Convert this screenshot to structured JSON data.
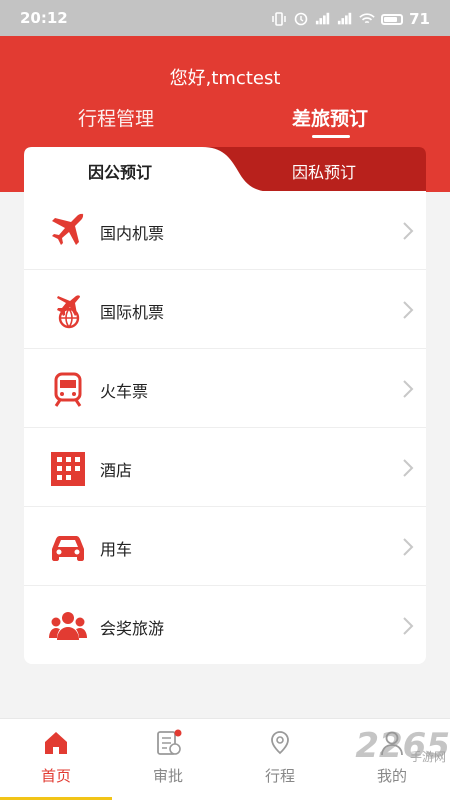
{
  "status_bar": {
    "time": "20:12",
    "battery": "71"
  },
  "header": {
    "greeting": "您好,tmctest",
    "tabs": [
      {
        "label": "行程管理",
        "active": false
      },
      {
        "label": "差旅预订",
        "active": true
      }
    ]
  },
  "booking_tabs": [
    {
      "label": "因公预订",
      "active": true
    },
    {
      "label": "因私预订",
      "active": false
    }
  ],
  "services": [
    {
      "label": "国内机票",
      "icon": "plane-icon"
    },
    {
      "label": "国际机票",
      "icon": "globe-plane-icon"
    },
    {
      "label": "火车票",
      "icon": "train-icon"
    },
    {
      "label": "酒店",
      "icon": "hotel-icon"
    },
    {
      "label": "用车",
      "icon": "car-icon"
    },
    {
      "label": "会奖旅游",
      "icon": "group-icon"
    }
  ],
  "bottom_nav": [
    {
      "label": "首页",
      "icon": "home-icon",
      "active": true
    },
    {
      "label": "审批",
      "icon": "approval-icon",
      "active": false
    },
    {
      "label": "行程",
      "icon": "location-icon",
      "active": false
    },
    {
      "label": "我的",
      "icon": "user-icon",
      "active": false
    }
  ],
  "watermark": {
    "main": "2265",
    "sub": "手游网"
  },
  "colors": {
    "accent": "#e23b32",
    "dark_tab": "#b8211c",
    "indicator": "#f2c417"
  }
}
